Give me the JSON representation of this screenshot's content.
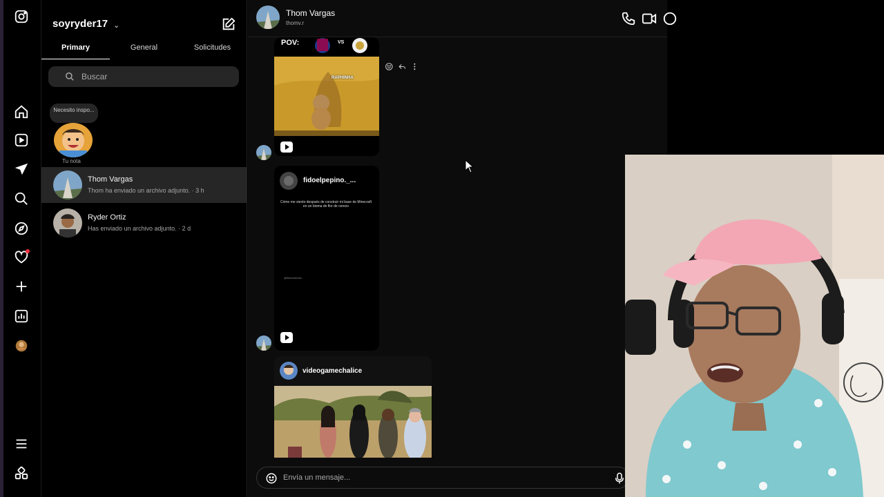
{
  "sidebar": {
    "icons": [
      "instagram-icon",
      "home-icon",
      "reels-icon",
      "messages-icon",
      "search-icon",
      "explore-icon",
      "notifications-icon",
      "create-icon",
      "dashboard-icon",
      "profile-avatar",
      "menu-icon",
      "meta-apps-icon"
    ]
  },
  "inbox": {
    "username": "soyryder17",
    "tabs": [
      "Primary",
      "General",
      "Solicitudes"
    ],
    "active_tab": "Primary",
    "search_placeholder": "Buscar",
    "note": {
      "text": "Necesito inspo...",
      "label": "Tu nota"
    },
    "threads": [
      {
        "name": "Thom Vargas",
        "preview": "Thom ha enviado un archivo adjunto. · 3 h",
        "selected": true
      },
      {
        "name": "Ryder Ortiz",
        "preview": "Has enviado un archivo adjunto. · 2 d",
        "selected": false
      }
    ]
  },
  "chat": {
    "name": "Thom Vargas",
    "handle": "thomv.r",
    "messages": [
      {
        "type": "reel",
        "overlay_top": "POV:",
        "overlay_vs": "VS",
        "overlay_label": "RAPHINHA"
      },
      {
        "type": "reel",
        "owner": "fidoelpepino._...",
        "caption": "Cómo me siento después de construir mi base de Minecraft en un bioma de flor de cerezo",
        "watermark": "@fidoememes"
      },
      {
        "type": "post",
        "owner": "videogamechalice"
      }
    ],
    "composer_placeholder": "Envía un mensaje..."
  },
  "colors": {
    "background": "#000000",
    "panel": "#0c0c0c",
    "selected": "#262626",
    "accent_red": "#ff3040"
  }
}
